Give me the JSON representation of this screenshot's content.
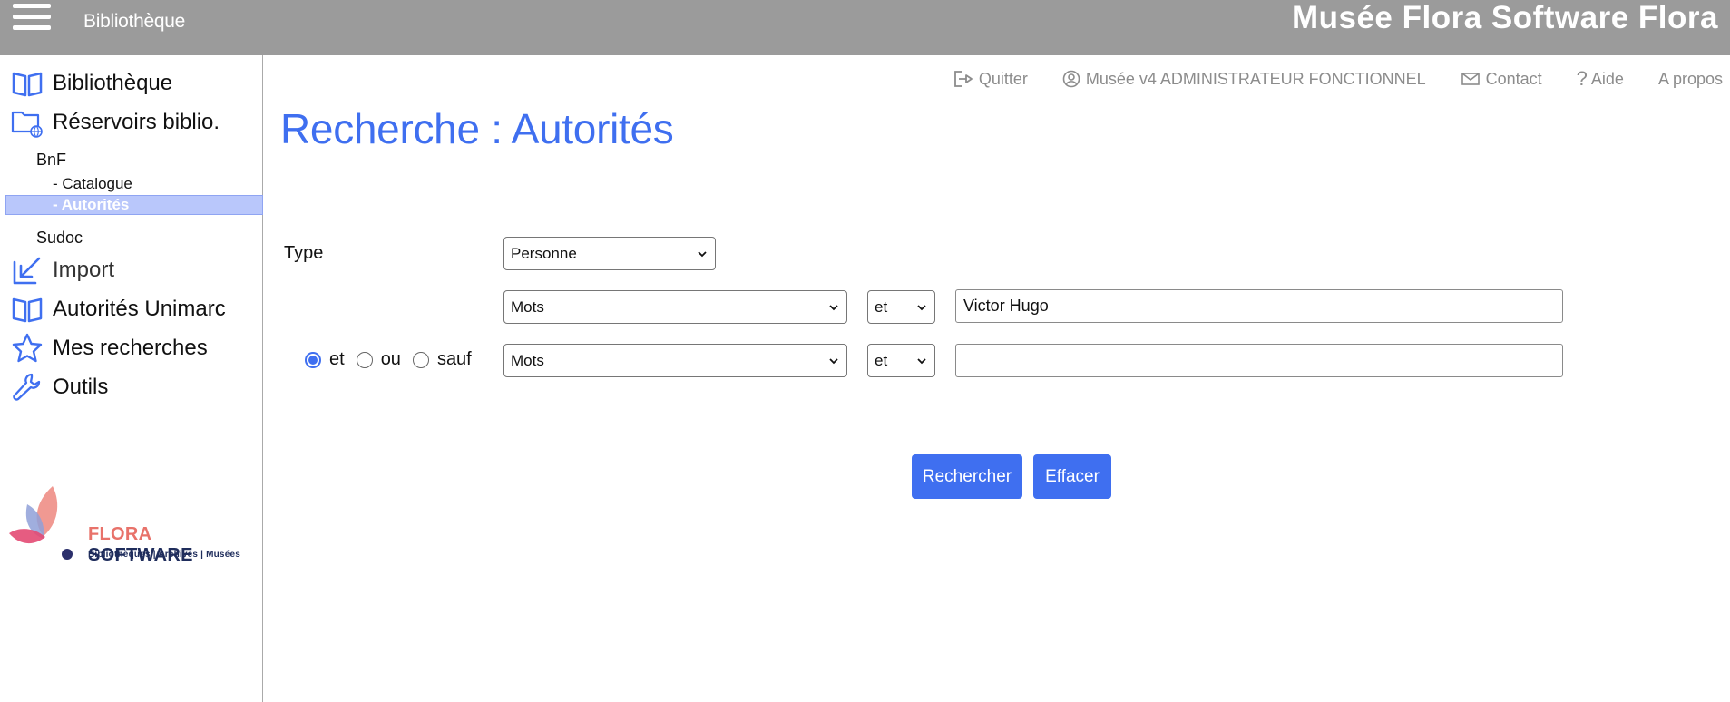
{
  "header": {
    "section_title": "Bibliothèque",
    "brand": "Musée Flora Software Flora"
  },
  "sidebar": {
    "items": [
      {
        "label": "Bibliothèque",
        "icon": "book-open-icon"
      },
      {
        "label": "Réservoirs biblio.",
        "icon": "folder-globe-icon"
      },
      {
        "label": "Import",
        "icon": "import-arrow-icon"
      },
      {
        "label": "Autorités Unimarc",
        "icon": "book-open-icon"
      },
      {
        "label": "Mes recherches",
        "icon": "star-icon"
      },
      {
        "label": "Outils",
        "icon": "wrench-icon"
      }
    ],
    "reservoirs": {
      "bnf": {
        "label": "BnF",
        "children": [
          "- Catalogue",
          "- Autorités"
        ]
      },
      "sudoc": {
        "label": "Sudoc"
      }
    },
    "logo": {
      "word1": "FLORA",
      "word2": "SOFTWARE",
      "tagline": "Bibliothèques | Archives | Musées"
    }
  },
  "toplinks": {
    "quit": "Quitter",
    "user": "Musée v4 ADMINISTRATEUR FONCTIONNEL",
    "contact": "Contact",
    "help": "Aide",
    "about": "A propos"
  },
  "page": {
    "title": "Recherche : Autorités"
  },
  "form": {
    "type_label": "Type",
    "type_value": "Personne",
    "row1": {
      "field": "Mots",
      "operator": "et",
      "value": "Victor Hugo"
    },
    "row2": {
      "bool_options": [
        "et",
        "ou",
        "sauf"
      ],
      "bool_selected": "et",
      "field": "Mots",
      "operator": "et",
      "value": ""
    },
    "search_button": "Rechercher",
    "clear_button": "Effacer"
  },
  "colors": {
    "accent": "#3f6ff0",
    "header_bg": "#9b9b9b",
    "active_row": "#b9c7fb",
    "logo_pink": "#e8726a",
    "logo_navy": "#1f2d5c"
  }
}
